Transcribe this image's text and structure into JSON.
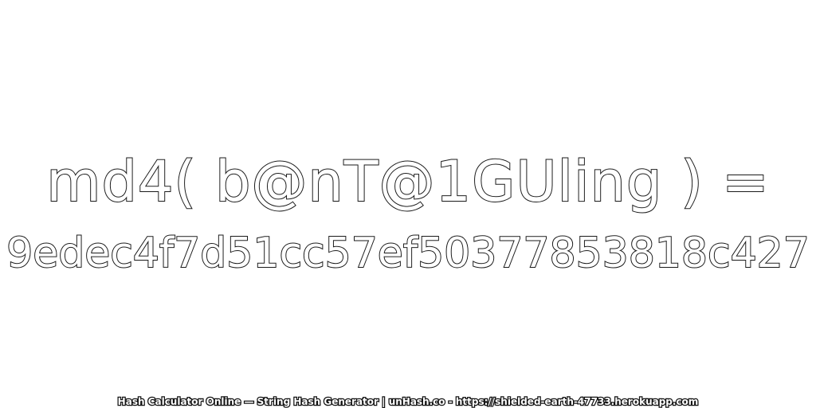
{
  "heading": {
    "expression": "md4( b@nT@1GUling ) =",
    "hash_value": "9edec4f7d51cc57ef50377853818c427"
  },
  "footer": {
    "credit": "Hash Calculator Online — String Hash Generator | unHash.co - https://shielded-earth-47733.herokuapp.com"
  },
  "colors": {
    "background": "#ffffff",
    "text_fill": "#ffffff",
    "text_outline": "#1a1a1a"
  }
}
